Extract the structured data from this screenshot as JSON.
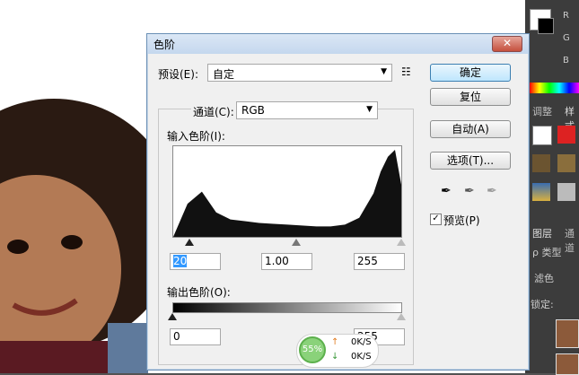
{
  "dialog": {
    "title": "色阶",
    "close": "✕",
    "preset_label": "预设(E):",
    "preset_value": "自定",
    "preset_menu_icon": "list-icon",
    "channel_label": "通道(C):",
    "channel_value": "RGB",
    "input_levels_label": "输入色阶(I):",
    "input_black": "20",
    "input_gamma": "1.00",
    "input_white": "255",
    "output_levels_label": "输出色阶(O):",
    "output_black": "0",
    "output_white": "255",
    "buttons": {
      "ok": "确定",
      "reset": "复位",
      "auto": "自动(A)",
      "options": "选项(T)..."
    },
    "preview_label": "预览(P)",
    "preview_checked": "✓"
  },
  "right_panel": {
    "channels": [
      "R",
      "G",
      "B"
    ],
    "tabs": [
      "调整",
      "样式"
    ],
    "layers_tabs": [
      "图层",
      "通道"
    ],
    "kind_label": "ρ 类型",
    "filter_label": "滤色",
    "lock_label": "锁定:"
  },
  "net_widget": {
    "percent": "55%",
    "up": "0K/S",
    "down": "0K/S"
  },
  "colors": {
    "accent": "#3399ff",
    "title_bar": "#c4d7ee",
    "close_button": "#c5503d",
    "panel_bg": "#3c3c3c"
  },
  "chart_data": {
    "type": "area",
    "x": [
      0,
      16,
      32,
      48,
      64,
      80,
      96,
      112,
      128,
      144,
      160,
      176,
      192,
      208,
      224,
      232,
      240,
      248,
      255
    ],
    "values": [
      0,
      38,
      52,
      28,
      20,
      18,
      16,
      15,
      14,
      13,
      12,
      12,
      14,
      22,
      50,
      75,
      92,
      100,
      60
    ],
    "xlim": [
      0,
      255
    ]
  }
}
